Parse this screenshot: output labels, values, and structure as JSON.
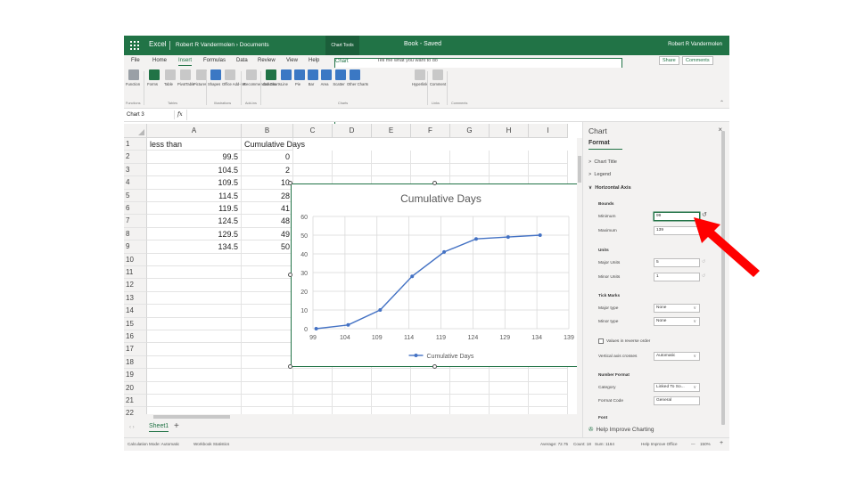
{
  "titlebar": {
    "app_name": "Excel",
    "breadcrumb": "Robert R Vandermolen › Documents",
    "context_tab": "Chart Tools",
    "document": "Book  -  Saved",
    "user": "Robert R Vandermolen"
  },
  "tabs": {
    "file": "File",
    "home": "Home",
    "insert": "Insert",
    "formulas": "Formulas",
    "data": "Data",
    "review": "Review",
    "view": "View",
    "help": "Help",
    "chart": "Chart",
    "tell_me": "Tell me what you want to do",
    "share": "Share",
    "comments": "Comments"
  },
  "ribbon": {
    "buttons": [
      {
        "label": "Function",
        "color": "#9aa0a6"
      },
      {
        "label": "Forms",
        "color": "#217346"
      },
      {
        "label": "Table",
        "color": "#c8c8c8"
      },
      {
        "label": "PivotTable",
        "color": "#c8c8c8"
      },
      {
        "label": "Pictures",
        "color": "#c8c8c8"
      },
      {
        "label": "Shapes",
        "color": "#3b78c4"
      },
      {
        "label": "Office Add-ins",
        "color": "#c8c8c8"
      },
      {
        "label": "Recommended Charts",
        "color": "#c8c8c8"
      },
      {
        "label": "Column",
        "color": "#217346"
      },
      {
        "label": "Line",
        "color": "#3b78c4"
      },
      {
        "label": "Pie",
        "color": "#3b78c4"
      },
      {
        "label": "Bar",
        "color": "#3b78c4"
      },
      {
        "label": "Area",
        "color": "#3b78c4"
      },
      {
        "label": "Scatter",
        "color": "#3b78c4"
      },
      {
        "label": "Other Charts",
        "color": "#3b78c4"
      },
      {
        "label": "Hyperlink",
        "color": "#c8c8c8"
      },
      {
        "label": "Comment",
        "color": "#c8c8c8"
      }
    ],
    "groups": [
      "Functions",
      "Tables",
      "Illustrations",
      "Add-ins",
      "Charts",
      "Links",
      "Comments"
    ]
  },
  "formula_bar": {
    "name_box": "Chart 3",
    "fx": "fx",
    "value": ""
  },
  "columns": [
    "A",
    "B",
    "C",
    "D",
    "E",
    "F",
    "G",
    "H",
    "I"
  ],
  "rows": [
    "1",
    "2",
    "3",
    "4",
    "5",
    "6",
    "7",
    "8",
    "9",
    "10",
    "11",
    "12",
    "13",
    "14",
    "15",
    "16",
    "17",
    "18",
    "19",
    "20",
    "21",
    "22"
  ],
  "cells": {
    "a1": "less than",
    "b1": "Cumulative Days",
    "col_a": [
      "99.5",
      "104.5",
      "109.5",
      "114.5",
      "119.5",
      "124.5",
      "129.5",
      "134.5"
    ],
    "col_b": [
      "0",
      "2",
      "10",
      "28",
      "41",
      "48",
      "49",
      "50"
    ]
  },
  "chart_data": {
    "type": "line",
    "title": "Cumulative Days",
    "x": [
      99.5,
      104.5,
      109.5,
      114.5,
      119.5,
      124.5,
      129.5,
      134.5
    ],
    "series": [
      {
        "name": "Cumulative Days",
        "values": [
          0,
          2,
          10,
          28,
          41,
          48,
          49,
          50
        ],
        "color": "#4472c4"
      }
    ],
    "xticks": [
      "99",
      "104",
      "109",
      "114",
      "119",
      "124",
      "129",
      "134",
      "139"
    ],
    "yticks": [
      "0",
      "10",
      "20",
      "30",
      "40",
      "50",
      "60"
    ],
    "xlim": [
      99,
      139
    ],
    "ylim": [
      0,
      60
    ],
    "grid": true,
    "legend": "bottom",
    "xlabel": "",
    "ylabel": ""
  },
  "sheet": {
    "tab": "Sheet1",
    "add": "+"
  },
  "status": {
    "calc_mode": "Calculation Mode: Automatic",
    "workbook_stats": "Workbook Statistics",
    "average": "Average: 72.75",
    "count": "Count: 18",
    "sum": "Sum: 1164",
    "help": "Help Improve Office",
    "zoom": "150%"
  },
  "pane": {
    "title": "Chart",
    "close": "×",
    "tab": "Format",
    "chart_title": "Chart Title",
    "legend": "Legend",
    "horizontal_axis": "Horizontal Axis",
    "bounds": "Bounds",
    "minimum_label": "Minimum",
    "minimum_value": "99",
    "maximum_label": "Maximum",
    "maximum_value": "139",
    "units": "Units",
    "major_units_label": "Major Units",
    "major_units_value": "5",
    "minor_units_label": "Minor Units",
    "minor_units_value": "1",
    "tick_marks": "Tick Marks",
    "major_type_label": "Major type",
    "major_type_value": "None",
    "minor_type_label": "Minor type",
    "minor_type_value": "None",
    "reverse_order": "Values in reverse order",
    "vertical_axis_crosses_label": "Vertical axis crosses",
    "vertical_axis_crosses_value": "Automatic",
    "number_format": "Number Format",
    "category_label": "Category",
    "category_value": "Linked To So...",
    "format_code_label": "Format Code",
    "format_code_value": "General",
    "font": "Font",
    "help": "Help Improve Charting"
  },
  "annotation": {
    "arrow_color": "#ff0000"
  }
}
